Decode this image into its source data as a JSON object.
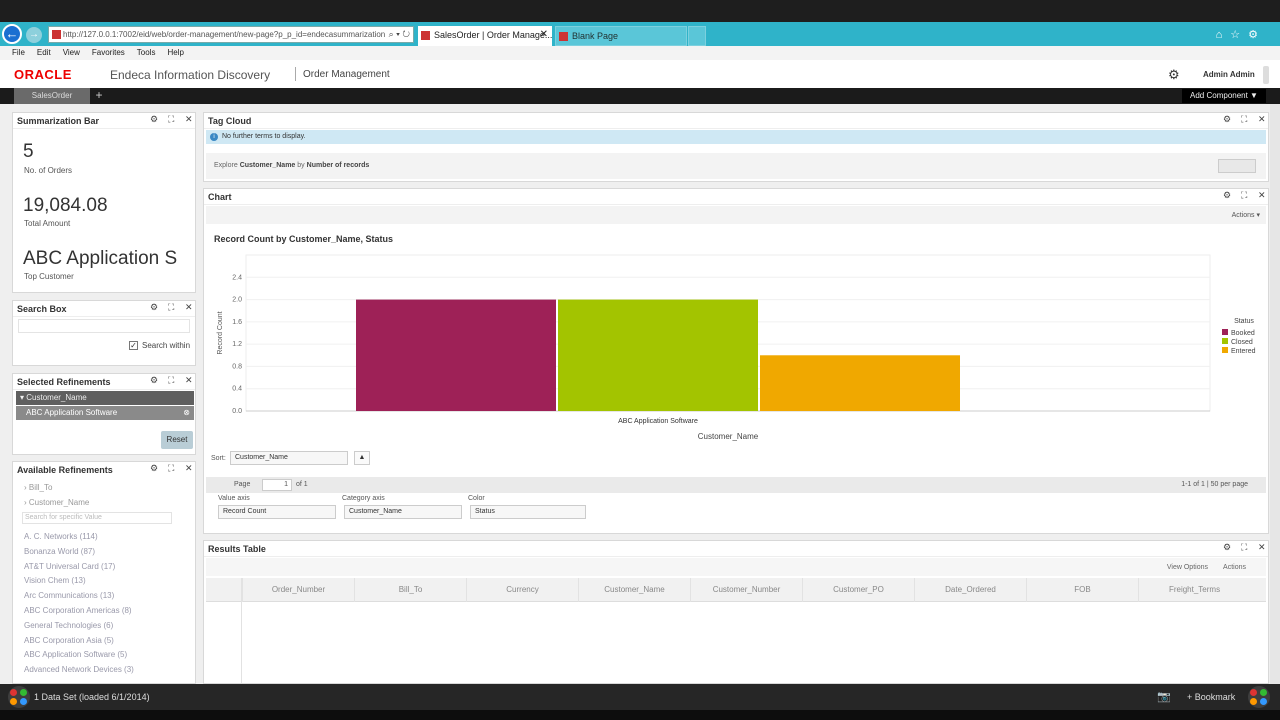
{
  "browser": {
    "url": "http://127.0.0.1:7002/eid/web/order-management/new-page?p_p_id=endecasummarization",
    "active_tab": "SalesOrder | Order Manage...",
    "blank_tab": "Blank Page",
    "menu": [
      "File",
      "Edit",
      "View",
      "Favorites",
      "Tools",
      "Help"
    ]
  },
  "app": {
    "logo": "ORACLE",
    "name": "Endeca Information Discovery",
    "page": "Order Management",
    "user": "Admin Admin",
    "page_tab": "SalesOrder",
    "add_component": "Add Component ▼"
  },
  "summarization": {
    "title": "Summarization Bar",
    "metrics": [
      {
        "value": "5",
        "label": "No. of Orders"
      },
      {
        "value": "19,084.08",
        "label": "Total Amount"
      },
      {
        "value": "ABC Application S",
        "label": "Top Customer"
      }
    ]
  },
  "search_box": {
    "title": "Search Box",
    "checkbox_label": "Search within",
    "checked": true
  },
  "selected_refinements": {
    "title": "Selected Refinements",
    "attribute": "Customer_Name",
    "value": "ABC Application Software",
    "reset": "Reset"
  },
  "available_refinements": {
    "title": "Available Refinements",
    "groups": [
      "Bill_To",
      "Customer_Name"
    ],
    "search_placeholder": "Search for specific Value",
    "values": [
      "A. C. Networks (114)",
      "Bonanza World (87)",
      "AT&T Universal Card (17)",
      "Vision Chem (13)",
      "Arc Communications (13)",
      "ABC Corporation Americas (8)",
      "General Technologies (6)",
      "ABC Corporation Asia (5)",
      "ABC Application Software (5)",
      "Advanced Network Devices (3)"
    ]
  },
  "tag_cloud": {
    "title": "Tag Cloud",
    "alert": "No further terms to display.",
    "explore_prefix": "Explore",
    "explore_attr": "Customer_Name",
    "explore_by": "by",
    "explore_metric": "Number of records"
  },
  "chart_panel": {
    "title": "Chart",
    "actions": "Actions",
    "sort_label": "Sort:",
    "sort_value": "Customer_Name",
    "page_label": "Page",
    "page_value": "1",
    "page_of": "of 1",
    "page_info": "1-1 of 1  |  50 per page",
    "value_axis_label": "Value axis",
    "value_axis": "Record Count",
    "category_axis_label": "Category axis",
    "category_axis": "Customer_Name",
    "color_label": "Color",
    "color": "Status"
  },
  "chart_data": {
    "type": "bar",
    "title": "Record Count by Customer_Name, Status",
    "xlabel": "Customer_Name",
    "ylabel": "Record Count",
    "ylim": [
      0,
      2.8
    ],
    "yticks": [
      "0.0",
      "0.4",
      "0.8",
      "1.2",
      "1.6",
      "2.0",
      "2.4"
    ],
    "categories": [
      "ABC Application Software"
    ],
    "series": [
      {
        "name": "Booked",
        "values": [
          2
        ],
        "color": "#9e2157"
      },
      {
        "name": "Closed",
        "values": [
          2
        ],
        "color": "#a3c400"
      },
      {
        "name": "Entered",
        "values": [
          1
        ],
        "color": "#f0a800"
      }
    ],
    "legend_title": "Status",
    "legend_position": "right"
  },
  "results_table": {
    "title": "Results Table",
    "view_options": "View Options",
    "actions": "Actions",
    "columns": [
      "Order_Number",
      "Bill_To",
      "Currency",
      "Customer_Name",
      "Customer_Number",
      "Customer_PO",
      "Date_Ordered",
      "FOB",
      "Freight_Terms"
    ]
  },
  "status": {
    "dataset": "1 Data Set (loaded 6/1/2014)",
    "bookmark": "Bookmark"
  }
}
